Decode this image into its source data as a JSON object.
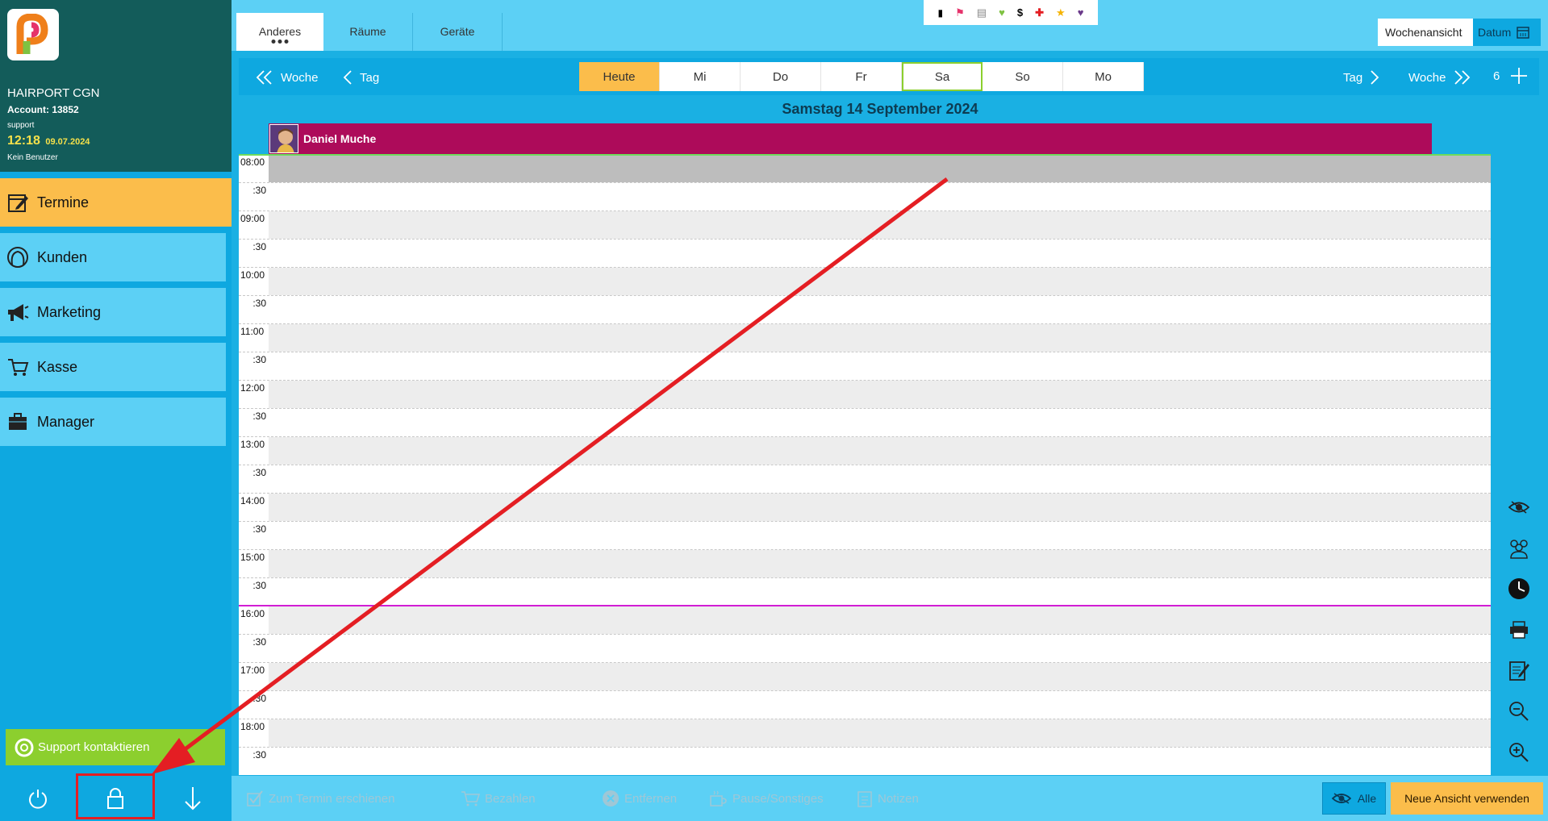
{
  "sidebar": {
    "company": "HAIRPORT CGN",
    "account": "Account: 13852",
    "user": "support",
    "time": "12:18",
    "date": "09.07.2024",
    "no_user": "Kein Benutzer",
    "items": [
      {
        "label": "Termine",
        "icon": "calendar-edit-icon"
      },
      {
        "label": "Kunden",
        "icon": "customer-head-icon"
      },
      {
        "label": "Marketing",
        "icon": "megaphone-icon"
      },
      {
        "label": "Kasse",
        "icon": "cart-icon"
      },
      {
        "label": "Manager",
        "icon": "briefcase-icon"
      }
    ],
    "support_label": "Support kontaktieren"
  },
  "tabs": [
    {
      "label": "Anderes"
    },
    {
      "label": "Räume"
    },
    {
      "label": "Geräte"
    }
  ],
  "view": {
    "week_label": "Wochenansicht",
    "date_label": "Datum"
  },
  "navbar": {
    "prev_week": "Woche",
    "prev_day": "Tag",
    "next_day": "Tag",
    "next_week": "Woche",
    "count": "6",
    "days": [
      "Heute",
      "Mi",
      "Do",
      "Fr",
      "Sa",
      "So",
      "Mo"
    ]
  },
  "calendar": {
    "title": "Samstag 14 September 2024",
    "staff_name": "Daniel Muche",
    "times": [
      "08:00",
      ":30",
      "09:00",
      ":30",
      "10:00",
      ":30",
      "11:00",
      ":30",
      "12:00",
      ":30",
      "13:00",
      ":30",
      "14:00",
      ":30",
      "15:00",
      ":30",
      "16:00",
      ":30",
      "17:00",
      ":30",
      "18:00",
      ":30"
    ]
  },
  "bottom": {
    "appeared": "Zum Termin erschienen",
    "pay": "Bezahlen",
    "remove": "Entfernen",
    "pause": "Pause/Sonstiges",
    "notes": "Notizen",
    "all": "Alle",
    "new_view": "Neue Ansicht verwenden"
  },
  "colors": {
    "accent_orange": "#fbbd4b",
    "sidebar_dark": "#135c5a",
    "staff_color": "#ad0b5a",
    "now_line": "#d21dd4",
    "annotation_red": "#e41e23"
  }
}
